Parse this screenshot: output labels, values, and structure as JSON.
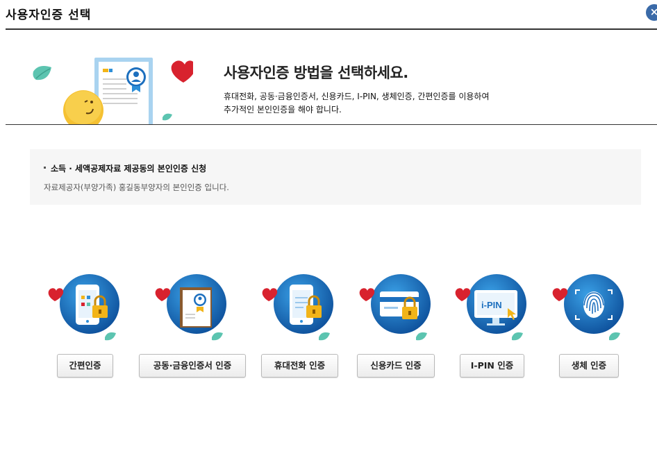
{
  "window": {
    "title": "사용자인증 선택",
    "close_label": "×"
  },
  "banner": {
    "headline": "사용자인증 방법을 선택하세요.",
    "desc_line1": "휴대전화, 공동·금융인증서, 신용카드, I-PIN, 생체인증, 간편인증를 이용하여",
    "desc_line2": "추가적인 본인인증을 해야 합니다."
  },
  "info": {
    "title": "소득 · 세액공제자료 제공동의 본인인증 신청",
    "text": "자료제공자(부양가족) 홍길동부양자의 본인인증 입니다."
  },
  "methods": [
    {
      "label": "간편인증",
      "icon": "simple-auth-icon"
    },
    {
      "label": "공동·금융인증서 인증",
      "icon": "certificate-icon"
    },
    {
      "label": "휴대전화 인증",
      "icon": "mobile-phone-icon"
    },
    {
      "label": "신용카드 인증",
      "icon": "credit-card-icon"
    },
    {
      "label": "I-PIN 인증",
      "icon": "ipin-icon"
    },
    {
      "label": "생체 인증",
      "icon": "fingerprint-icon"
    }
  ],
  "ipin_icon_text": "i-PIN",
  "colors": {
    "circle_dark": "#0f5aa8",
    "circle_light": "#2e8fd8",
    "heart": "#d8222e",
    "leaf": "#5cc4b0",
    "lock": "#f2b418",
    "smiley": "#f5c132"
  }
}
